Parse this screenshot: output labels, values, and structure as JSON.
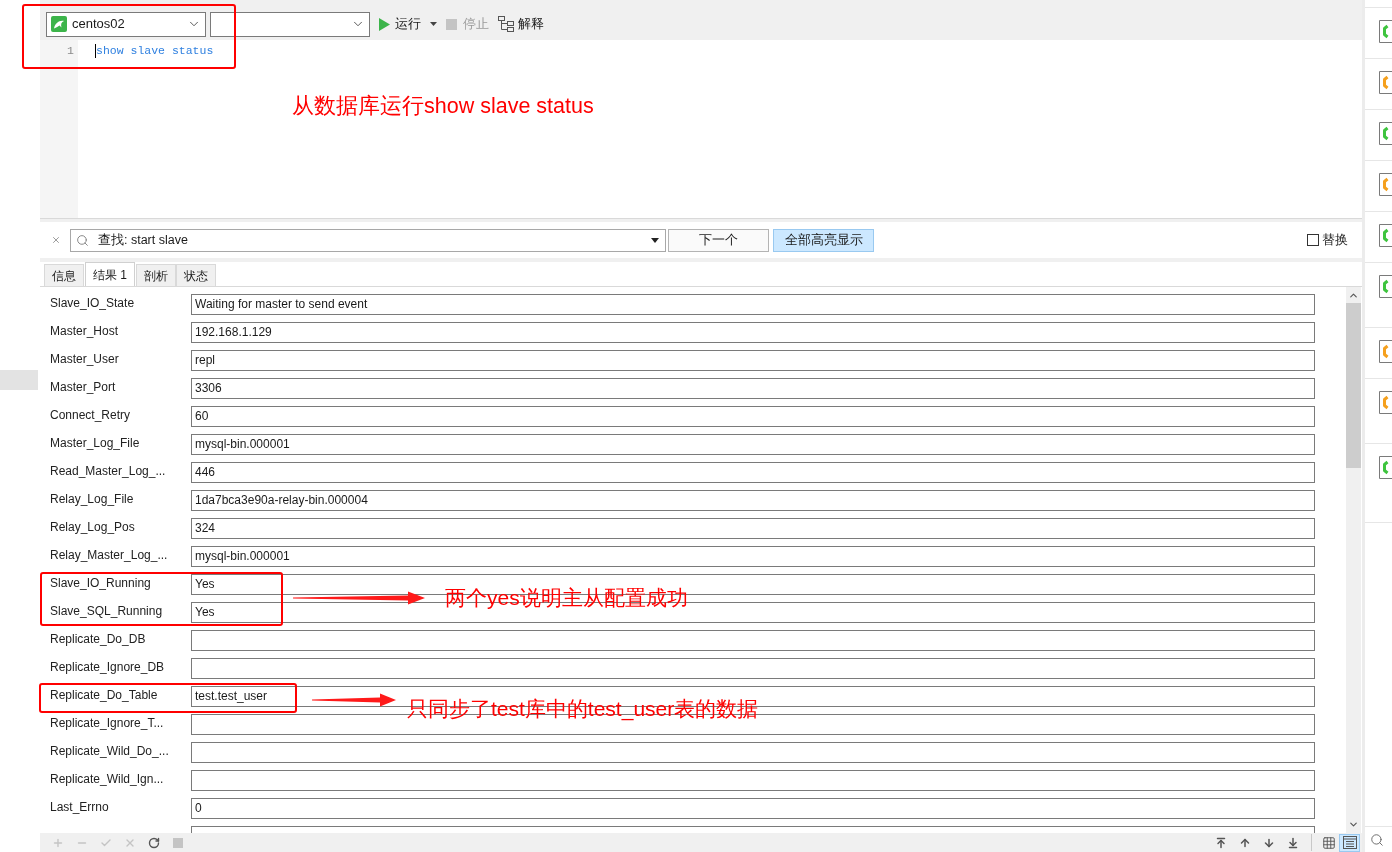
{
  "toolbar": {
    "selects": [
      {
        "kind": "connection",
        "value": "centos02"
      },
      {
        "kind": "database"
      }
    ],
    "run": {
      "label": "运行"
    },
    "stop": {
      "label": "停止",
      "disabled": true
    },
    "explain": {
      "label": "解释"
    }
  },
  "editor": {
    "lines": [
      {
        "number": "1",
        "code": "show slave status"
      }
    ]
  },
  "find_bar": {
    "query": "查找: start slave",
    "buttons": [
      {
        "label": "下一个",
        "selected": false
      },
      {
        "label": "全部高亮显示",
        "selected": true
      }
    ],
    "replace": {
      "label": "替换",
      "checked": false
    }
  },
  "tabs": [
    {
      "label": "信息",
      "selected": false
    },
    {
      "label": "结果 1",
      "selected": true
    },
    {
      "label": "剖析",
      "selected": false
    },
    {
      "label": "状态",
      "selected": false
    }
  ],
  "result_form": {
    "rows": [
      {
        "label": "Slave_IO_State",
        "value": "Waiting for master to send event"
      },
      {
        "label": "Master_Host",
        "value": "192.168.1.129"
      },
      {
        "label": "Master_User",
        "value": "repl"
      },
      {
        "label": "Master_Port",
        "value": "3306"
      },
      {
        "label": "Connect_Retry",
        "value": "60"
      },
      {
        "label": "Master_Log_File",
        "value": "mysql-bin.000001"
      },
      {
        "label": "Read_Master_Log_...",
        "value": "446"
      },
      {
        "label": "Relay_Log_File",
        "value": "1da7bca3e90a-relay-bin.000004"
      },
      {
        "label": "Relay_Log_Pos",
        "value": "324"
      },
      {
        "label": "Relay_Master_Log_...",
        "value": "mysql-bin.000001"
      },
      {
        "label": "Slave_IO_Running",
        "value": "Yes"
      },
      {
        "label": "Slave_SQL_Running",
        "value": "Yes"
      },
      {
        "label": "Replicate_Do_DB"
      },
      {
        "label": "Replicate_Ignore_DB"
      },
      {
        "label": "Replicate_Do_Table",
        "value": "test.test_user"
      },
      {
        "label": "Replicate_Ignore_T..."
      },
      {
        "label": "Replicate_Wild_Do_..."
      },
      {
        "label": "Replicate_Wild_Ign..."
      },
      {
        "label": "Last_Errno",
        "value": "0"
      }
    ]
  },
  "bottom_bar": {
    "record_buttons": [
      {
        "kind": "plus",
        "disabled": true
      },
      {
        "kind": "minus",
        "disabled": true
      },
      {
        "kind": "check",
        "disabled": true
      },
      {
        "kind": "cross",
        "disabled": true
      },
      {
        "kind": "refresh",
        "disabled": false
      },
      {
        "kind": "square",
        "disabled": true
      }
    ],
    "nav_buttons": [
      {
        "kind": "first"
      },
      {
        "kind": "previous"
      },
      {
        "kind": "next"
      },
      {
        "kind": "last"
      }
    ],
    "view_buttons": [
      {
        "kind": "grid",
        "selected": false
      },
      {
        "kind": "form",
        "selected": true
      }
    ]
  },
  "side_panel": {
    "items": [
      {
        "color": "#3ec43e"
      },
      {
        "color": "#f5a01e"
      },
      {
        "color": "#3ec43e"
      },
      {
        "color": "#f5a01e"
      },
      {
        "color": "#3ec43e"
      },
      {
        "color": "#3ec43e"
      },
      {
        "color": "#f5a01e"
      },
      {
        "color": "#f5a01e"
      },
      {
        "color": "#3ec43e"
      }
    ]
  },
  "annotations": [
    "从数据库运行show slave status",
    "两个yes说明主从配置成功",
    "只同步了test库中的test_user表的数据"
  ]
}
